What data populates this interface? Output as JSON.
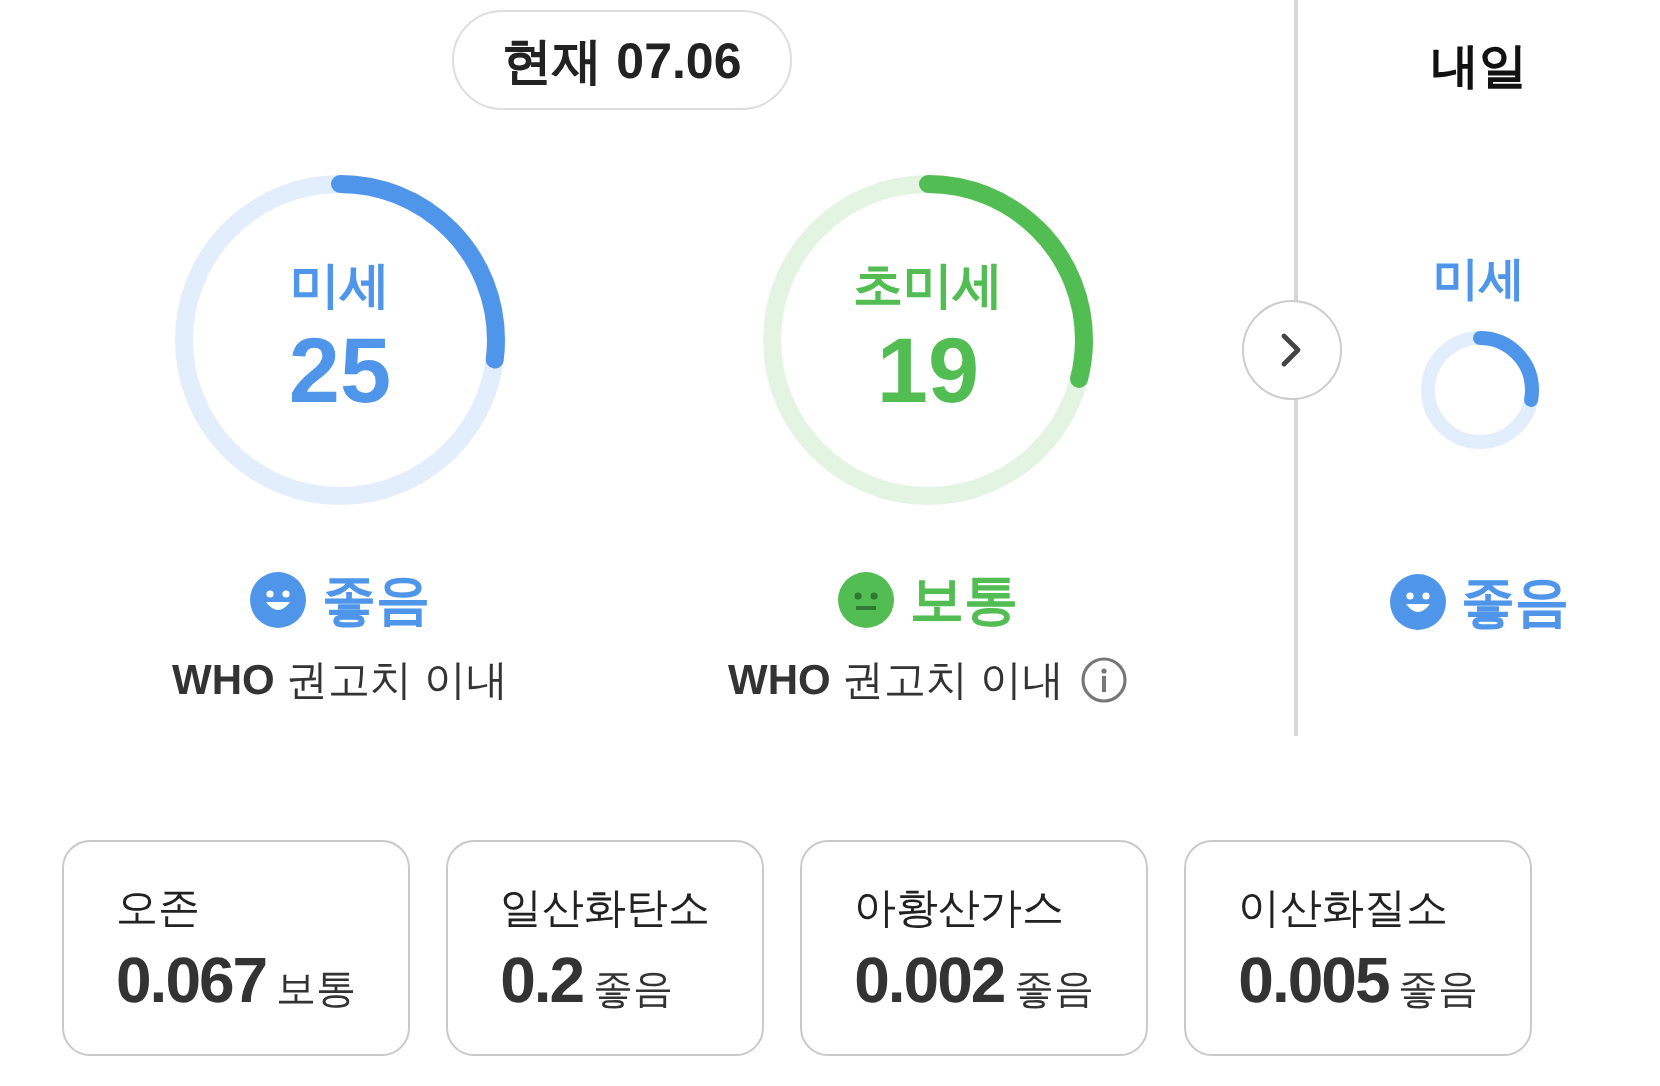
{
  "date_badge": "현재 07.06",
  "gauges": [
    {
      "label": "미세",
      "value": "25",
      "level": 0.27,
      "grade": "좋음",
      "kind": "smile",
      "color": "#4f96ea",
      "note": "**WHO** 권고치 이내",
      "info": false
    },
    {
      "label": "초미세",
      "value": "19",
      "level": 0.29,
      "grade": "보통",
      "kind": "neutral",
      "color": "#52bd52",
      "note": "**WHO** 권고치 이내",
      "info": true
    }
  ],
  "tomorrow": {
    "title": "내일",
    "gauges": [
      {
        "label": "미세",
        "level": 0.28,
        "grade": "좋음",
        "kind": "smile",
        "color": "#4f96ea"
      }
    ]
  },
  "pollutants": [
    {
      "name": "오존",
      "value": "0.067",
      "grade": "보통"
    },
    {
      "name": "일산화탄소",
      "value": "0.2",
      "grade": "좋음"
    },
    {
      "name": "아황산가스",
      "value": "0.002",
      "grade": "좋음"
    },
    {
      "name": "이산화질소",
      "value": "0.005",
      "grade": "좋음"
    }
  ]
}
